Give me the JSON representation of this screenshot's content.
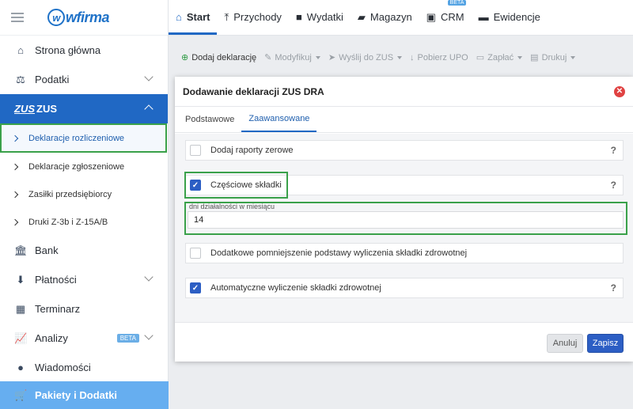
{
  "app": {
    "logo_text": "wfirma",
    "logo_letter": "w"
  },
  "sidebar": {
    "items": [
      {
        "label": "Strona główna",
        "icon": "home-building-icon",
        "glyph": "⌂"
      },
      {
        "label": "Podatki",
        "icon": "scales-icon",
        "glyph": "⚖"
      },
      {
        "label": "ZUS",
        "icon": "zus-logo-icon",
        "glyph": "ZUS"
      },
      {
        "label": "Deklaracje rozliczeniowe"
      },
      {
        "label": "Deklaracje zgłoszeniowe"
      },
      {
        "label": "Zasiłki przedsiębiorcy"
      },
      {
        "label": "Druki Z-3b i Z-15A/B"
      },
      {
        "label": "Bank",
        "icon": "bank-icon",
        "glyph": "🏛"
      },
      {
        "label": "Płatności",
        "icon": "download-icon",
        "glyph": "⬇"
      },
      {
        "label": "Terminarz",
        "icon": "calendar-icon",
        "glyph": "▦"
      },
      {
        "label": "Analizy",
        "icon": "chart-icon",
        "glyph": "📈",
        "badge": "BETA"
      },
      {
        "label": "Wiadomości",
        "icon": "chat-bubble-icon",
        "glyph": "●"
      },
      {
        "label": "Pakiety i Dodatki",
        "icon": "cart-icon",
        "glyph": "🛒"
      }
    ]
  },
  "topnav": {
    "tabs": [
      {
        "label": "Start",
        "glyph": "⌂"
      },
      {
        "label": "Przychody",
        "glyph": "⤒"
      },
      {
        "label": "Wydatki",
        "glyph": "■"
      },
      {
        "label": "Magazyn",
        "glyph": "▰"
      },
      {
        "label": "CRM",
        "glyph": "▣",
        "badge": "BETA"
      },
      {
        "label": "Ewidencje",
        "glyph": "▬"
      }
    ]
  },
  "toolbar": {
    "add": "Dodaj deklarację",
    "modify": "Modyfikuj",
    "send": "Wyślij do ZUS",
    "fetch": "Pobierz UPO",
    "pay": "Zapłać",
    "print": "Drukuj"
  },
  "modal": {
    "title": "Dodawanie deklaracji ZUS DRA",
    "close_glyph": "✕",
    "tabs": [
      "Podstawowe",
      "Zaawansowane"
    ],
    "options": [
      {
        "label": "Dodaj raporty zerowe",
        "checked": false,
        "help": "?"
      },
      {
        "label": "Częściowe składki",
        "checked": true,
        "help": "?"
      },
      {
        "label": "Dodatkowe pomniejszenie podstawy wyliczenia składki zdrowotnej",
        "checked": false
      },
      {
        "label": "Automatyczne wyliczenie składki zdrowotnej",
        "checked": true,
        "help": "?"
      }
    ],
    "field": {
      "label": "dni działalności w miesiącu",
      "value": "14"
    },
    "buttons": {
      "cancel": "Anuluj",
      "save": "Zapisz"
    }
  },
  "colors": {
    "primary": "#2068c4",
    "highlight": "#3aa14a",
    "close": "#e04242",
    "sidebar_bottom": "#66aef0"
  }
}
